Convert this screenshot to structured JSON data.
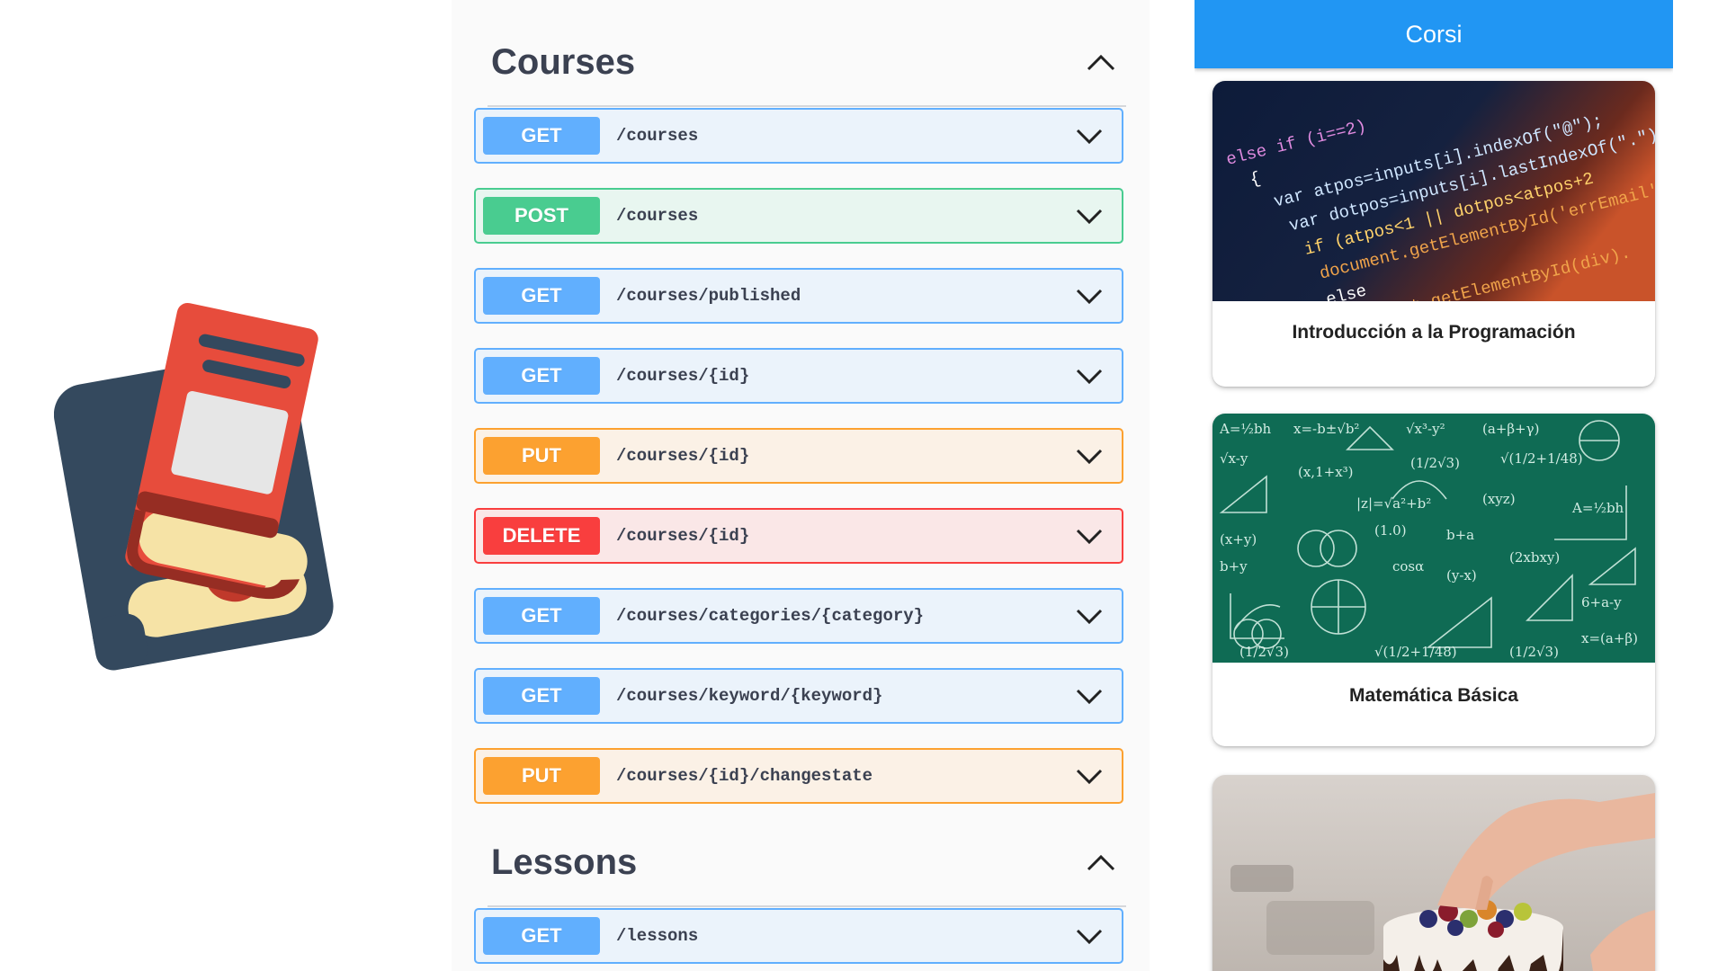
{
  "swagger": {
    "sections": [
      {
        "title": "Courses",
        "operations": [
          {
            "method": "GET",
            "path": "/courses"
          },
          {
            "method": "POST",
            "path": "/courses"
          },
          {
            "method": "GET",
            "path": "/courses/published"
          },
          {
            "method": "GET",
            "path": "/courses/{id}"
          },
          {
            "method": "PUT",
            "path": "/courses/{id}"
          },
          {
            "method": "DELETE",
            "path": "/courses/{id}"
          },
          {
            "method": "GET",
            "path": "/courses/categories/{category}"
          },
          {
            "method": "GET",
            "path": "/courses/keyword/{keyword}"
          },
          {
            "method": "PUT",
            "path": "/courses/{id}/changestate"
          }
        ]
      },
      {
        "title": "Lessons",
        "operations": [
          {
            "method": "GET",
            "path": "/lessons"
          }
        ]
      }
    ],
    "colors": {
      "get": "#61affe",
      "post": "#49cc90",
      "put": "#fca130",
      "delete": "#f93e3e"
    }
  },
  "app": {
    "title": "Corsi",
    "accent": "#2196f3",
    "courses": [
      {
        "title": "Introducción a la Programación",
        "image": "code-screen-image"
      },
      {
        "title": "Matemática Básica",
        "image": "chalkboard-math-image"
      },
      {
        "title": "",
        "image": "cake-decorating-image"
      }
    ],
    "code_lines": [
      "else if (i==2)",
      "{",
      "var atpos=inputs[i].indexOf(\"@\");",
      "var dotpos=inputs[i].lastIndexOf(\".\");",
      "if (atpos<1 || dotpos<atpos+2",
      "document.getElementById('errEmail')",
      "else",
      "document.getElementById(div)."
    ]
  }
}
